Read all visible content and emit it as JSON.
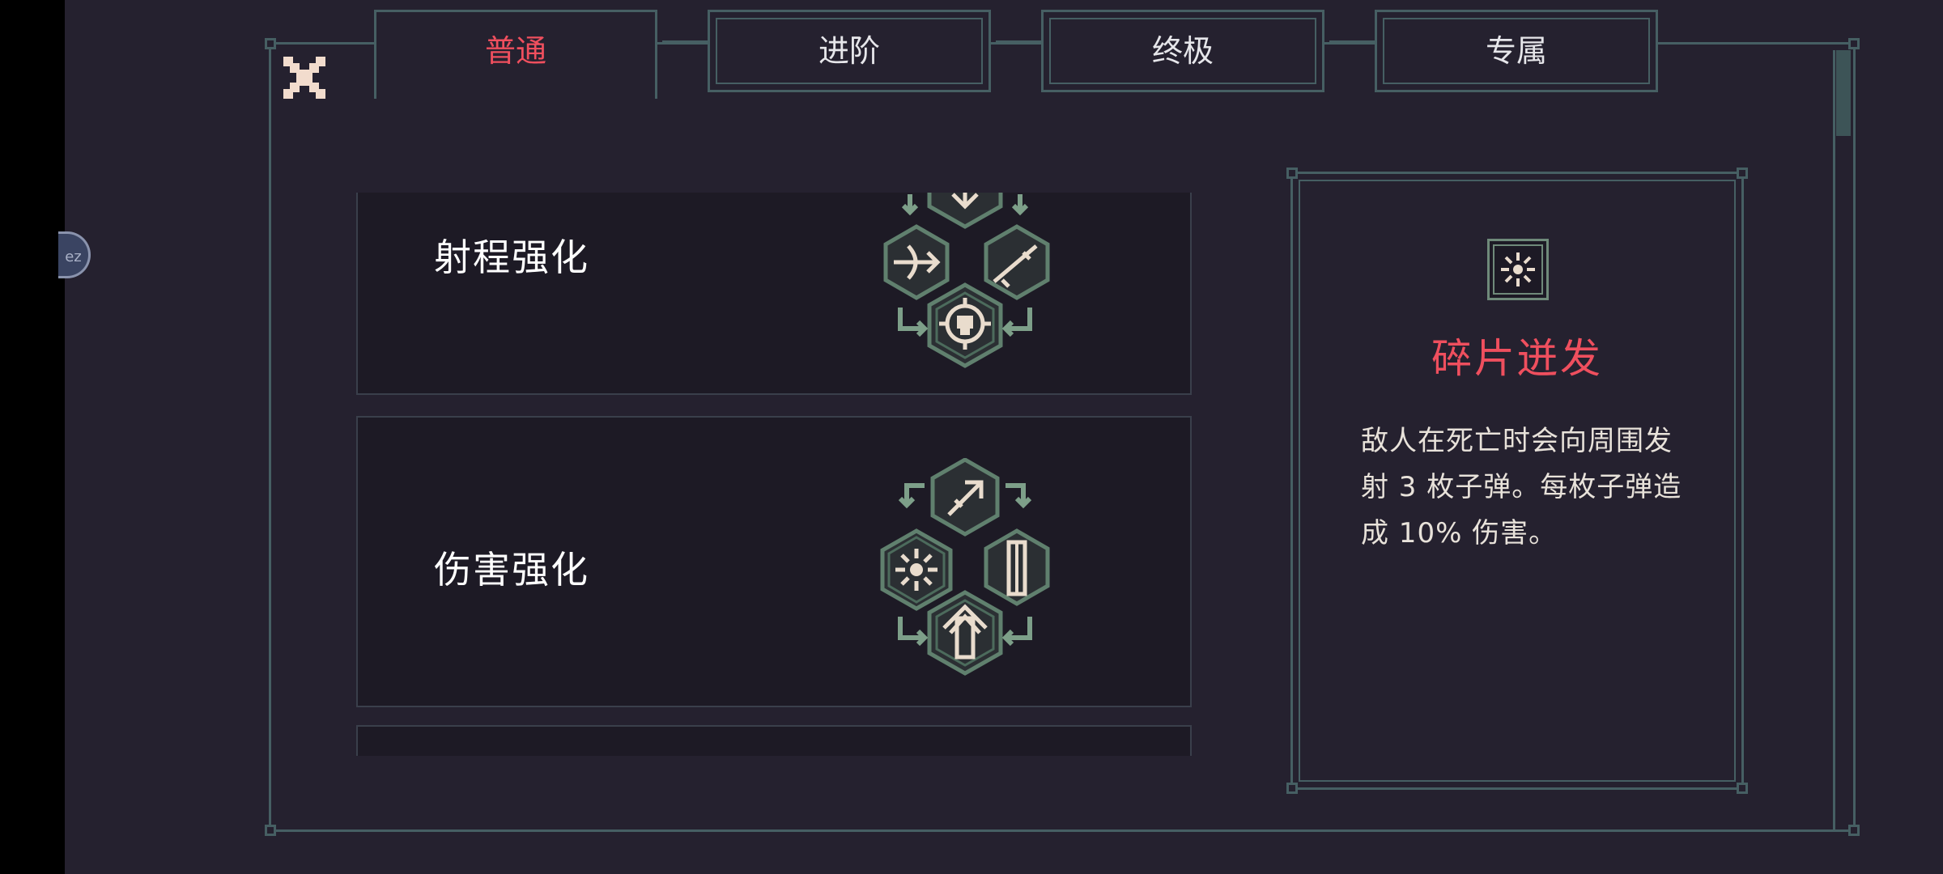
{
  "tabs": [
    {
      "label": "普通",
      "active": true
    },
    {
      "label": "进阶",
      "active": false
    },
    {
      "label": "终极",
      "active": false
    },
    {
      "label": "专属",
      "active": false
    }
  ],
  "upgrades": [
    {
      "title": "射程强化",
      "icons": [
        "crossbow-icon",
        "rifle-icon",
        "skull-crosshair-icon"
      ]
    },
    {
      "title": "伤害强化",
      "icons": [
        "bullet-streak-icon",
        "shatter-burst-icon",
        "shell-casing-icon",
        "bullet-crown-icon"
      ]
    }
  ],
  "detail": {
    "icon": "shatter-burst-icon",
    "title": "碎片迸发",
    "description": "敌人在死亡时会向周围发射 3 枚子弹。每枚子弹造成 10% 伤害。"
  },
  "colors": {
    "background": "#25212f",
    "frame": "#465f63",
    "active_tab_text": "#ef4f5e",
    "detail_title": "#ef4f5e",
    "icon_glyph": "#e9dccd"
  }
}
